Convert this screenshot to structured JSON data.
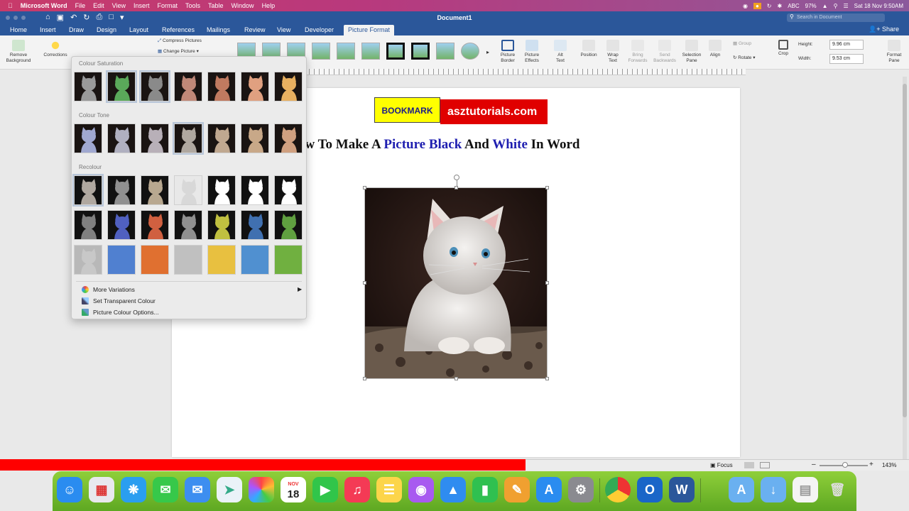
{
  "menubar": {
    "apple": "",
    "app": "Microsoft Word",
    "items": [
      "File",
      "Edit",
      "View",
      "Insert",
      "Format",
      "Tools",
      "Table",
      "Window",
      "Help"
    ],
    "status": {
      "input": "ABC",
      "battery": "97%",
      "datetime": "Sat 18 Nov  9:50AM"
    }
  },
  "window": {
    "title": "Document1",
    "search_placeholder": "Search in Document",
    "share": "Share"
  },
  "tabs": [
    "Home",
    "Insert",
    "Draw",
    "Design",
    "Layout",
    "References",
    "Mailings",
    "Review",
    "View",
    "Developer",
    "Picture Format"
  ],
  "active_tab": "Picture Format",
  "ribbon": {
    "remove_bg": "Remove\nBackground",
    "corrections": "Corrections",
    "compress": "Compress Pictures",
    "change": "Change Picture",
    "picture_border": "Picture\nBorder",
    "picture_effects": "Picture\nEffects",
    "alt_text": "Alt\nText",
    "position": "Position",
    "wrap_text": "Wrap\nText",
    "bring_forwards": "Bring\nForwards",
    "send_backwards": "Send\nBackwards",
    "selection_pane": "Selection\nPane",
    "align": "Align",
    "group": "Group",
    "rotate": "Rotate",
    "crop": "Crop",
    "height_label": "Height:",
    "height_value": "9.96 cm",
    "width_label": "Width:",
    "width_value": "9.53 cm",
    "format_pane": "Format\nPane"
  },
  "popup": {
    "colour_saturation": "Colour Saturation",
    "colour_tone": "Colour Tone",
    "recolour": "Recolour",
    "more_variations": "More Variations",
    "set_transparent": "Set Transparent Colour",
    "picture_colour_options": "Picture Colour Options...",
    "saturation_tints": [
      "#9a9a9a",
      "#5aa85a",
      "#8a8a8a",
      "#c08878",
      "#c07a60",
      "#e0a080",
      "#e8b060"
    ],
    "tone_tints": [
      "#a0a8d0",
      "#b0b0c0",
      "#b8b0b8",
      "#b0a8a0",
      "#c0a890",
      "#c8a888",
      "#d0a080"
    ],
    "recolour_rows": [
      [
        "#b0a8a0",
        "#909090",
        "#b8a890",
        "#d8d8d8",
        "#ffffff",
        "#ffffff",
        "#ffffff"
      ],
      [
        "#808080",
        "#5060c0",
        "#d06040",
        "#909090",
        "#c0c040",
        "#4070b0",
        "#60a040"
      ],
      [
        "#c8c8c8",
        "#5080d0",
        "#e07030",
        "#c0c0c0",
        "#e8c040",
        "#5090d0",
        "#70b040"
      ]
    ]
  },
  "document": {
    "bookmark": "BOOKMARK",
    "site": "asztutorials.com",
    "heading": [
      {
        "text": "ow To Make A ",
        "blue": false
      },
      {
        "text": "Picture Black",
        "blue": true
      },
      {
        "text": " And ",
        "blue": false
      },
      {
        "text": "White",
        "blue": true
      },
      {
        "text": " In Word",
        "blue": false
      }
    ]
  },
  "statusbar": {
    "focus": "Focus",
    "zoom": "143%"
  },
  "dock": {
    "calendar_month": "NOV",
    "calendar_day": "18"
  },
  "colors": {
    "word_blue": "#2b579a",
    "red": "#ff0000",
    "heading_blue": "#1f1fb0"
  }
}
